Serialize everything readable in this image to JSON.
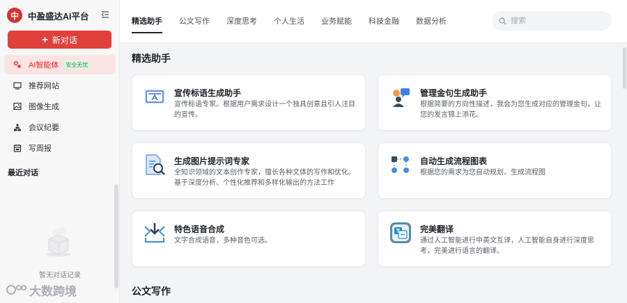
{
  "brand": {
    "logo_char": "中",
    "name": "中盈盛达AI平台"
  },
  "sidebar": {
    "new_chat_label": "新对话",
    "items": [
      {
        "label": "AI智能体",
        "badge": "安全无忧",
        "icon": "agent-icon",
        "active": true
      },
      {
        "label": "推荐网站",
        "icon": "monitor-icon"
      },
      {
        "label": "图像生成",
        "icon": "image-icon"
      },
      {
        "label": "会议纪要",
        "icon": "meeting-icon"
      },
      {
        "label": "写周报",
        "icon": "calendar-icon"
      }
    ],
    "recent_title": "最近对话",
    "empty_text": "暂无对话记录"
  },
  "watermark": "大数跨境",
  "header": {
    "tabs": [
      "精选助手",
      "公文写作",
      "深度思考",
      "个人生活",
      "业务赋能",
      "科技金融",
      "数据分析"
    ],
    "active_tab": "精选助手",
    "search_placeholder": "搜索"
  },
  "main": {
    "section_title": "精选助手",
    "next_section_title": "公文写作",
    "cards": [
      {
        "title": "宣传标语生成助手",
        "desc": "宣传标语专家。根据用户需求设计一个独具创意且引人注目的宣传。",
        "icon": "slogan-icon"
      },
      {
        "title": "管理金句生成助手",
        "desc": "根据简要的方向性描述，我会为您生成对应的管理金句，让您的发言锦上添花。",
        "icon": "chat-person-icon"
      },
      {
        "title": "生成图片提示词专家",
        "desc": "全知识领域的文本创作专家，擅长各种文体的写作和优化。基于深度分析、个性化推荐和多样化输出的方法工作",
        "icon": "document-search-icon"
      },
      {
        "title": "自动生成流程图表",
        "desc": "根据您的需求为您自动规划、生成流程图",
        "icon": "flowchart-icon"
      },
      {
        "title": "特色语音合成",
        "desc": "文字合成语音，多种音色可选。",
        "icon": "voice-download-icon"
      },
      {
        "title": "完美翻译",
        "desc": "通过人工智能进行中英文互译，人工智能自身进行深度思考，完美进行语言的翻译。",
        "icon": "translate-icon"
      }
    ]
  },
  "colors": {
    "accent": "#e0403a",
    "active_bg": "#fbe4e3",
    "badge_bg": "#dcf2e2",
    "badge_text": "#2f9a4f"
  }
}
